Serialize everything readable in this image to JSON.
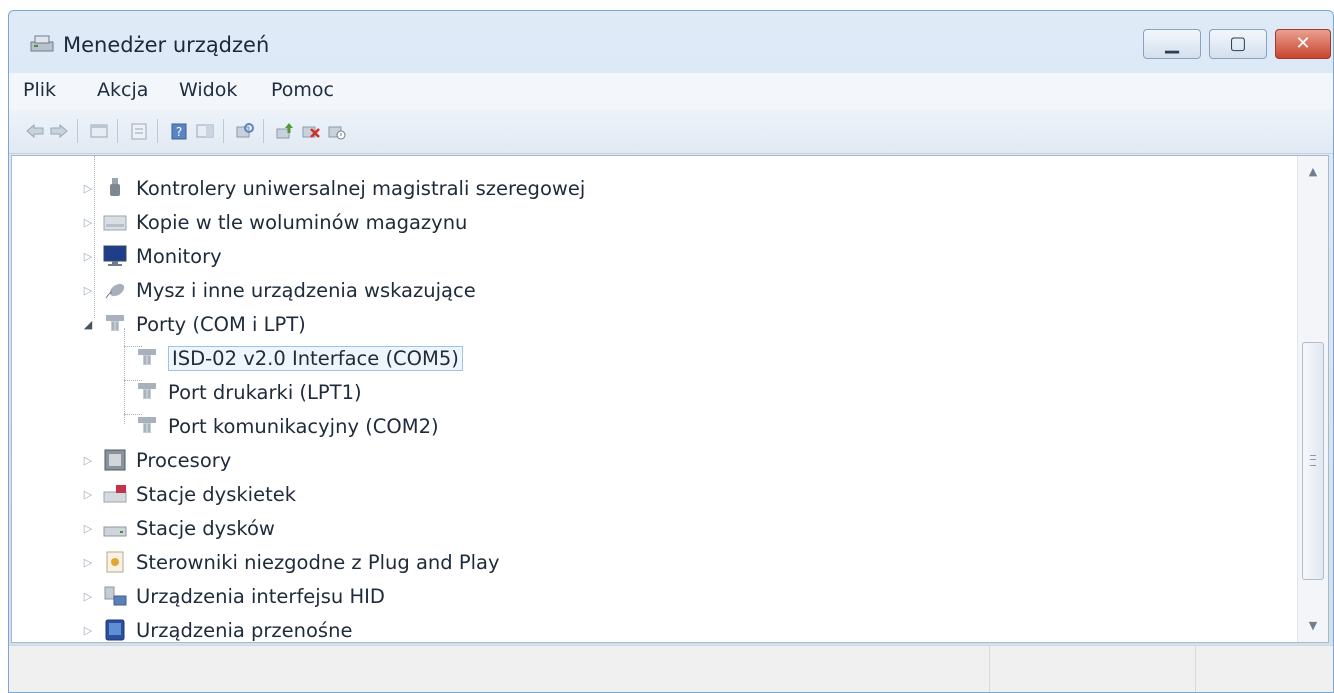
{
  "window": {
    "title": "Menedżer urządzeń",
    "controls": {
      "minimize_icon": "minimize-icon",
      "maximize_icon": "maximize-icon",
      "close_icon": "close-icon"
    }
  },
  "menu": {
    "items": [
      "Plik",
      "Akcja",
      "Widok",
      "Pomoc"
    ]
  },
  "toolbar": {
    "icons": [
      "back-arrow-icon",
      "forward-arrow-icon",
      "console-tree-icon",
      "properties-icon",
      "help-icon",
      "action-pane-icon",
      "scan-hardware-icon",
      "update-driver-icon",
      "uninstall-icon",
      "disable-device-icon"
    ]
  },
  "tree": {
    "items": [
      {
        "label": "Kontrolery uniwersalnej magistrali szeregowej",
        "icon": "usb-controller-icon",
        "expanded": false
      },
      {
        "label": "Kopie w tle woluminów magazynu",
        "icon": "storage-volume-icon",
        "expanded": false
      },
      {
        "label": "Monitory",
        "icon": "monitor-icon",
        "expanded": false
      },
      {
        "label": "Mysz i inne urządzenia wskazujące",
        "icon": "mouse-icon",
        "expanded": false
      },
      {
        "label": "Porty (COM i LPT)",
        "icon": "port-icon",
        "expanded": true
      },
      {
        "label": "ISD-02 v2.0 Interface (COM5)",
        "icon": "port-icon",
        "child": true,
        "selected": true
      },
      {
        "label": "Port drukarki (LPT1)",
        "icon": "port-icon",
        "child": true
      },
      {
        "label": "Port komunikacyjny (COM2)",
        "icon": "port-icon",
        "child": true
      },
      {
        "label": "Procesory",
        "icon": "processor-icon",
        "expanded": false
      },
      {
        "label": "Stacje dyskietek",
        "icon": "floppy-drive-icon",
        "expanded": false
      },
      {
        "label": "Stacje dysków",
        "icon": "disk-drive-icon",
        "expanded": false
      },
      {
        "label": "Sterowniki niezgodne z Plug and Play",
        "icon": "legacy-driver-icon",
        "expanded": false
      },
      {
        "label": "Urządzenia interfejsu HID",
        "icon": "hid-device-icon",
        "expanded": false
      },
      {
        "label": "Urządzenia przenośne",
        "icon": "portable-device-icon",
        "expanded": false
      }
    ]
  },
  "colors": {
    "titlebar": "#dfeaf7",
    "close_button": "#c9442f",
    "selection_border": "#9ec3e6"
  }
}
